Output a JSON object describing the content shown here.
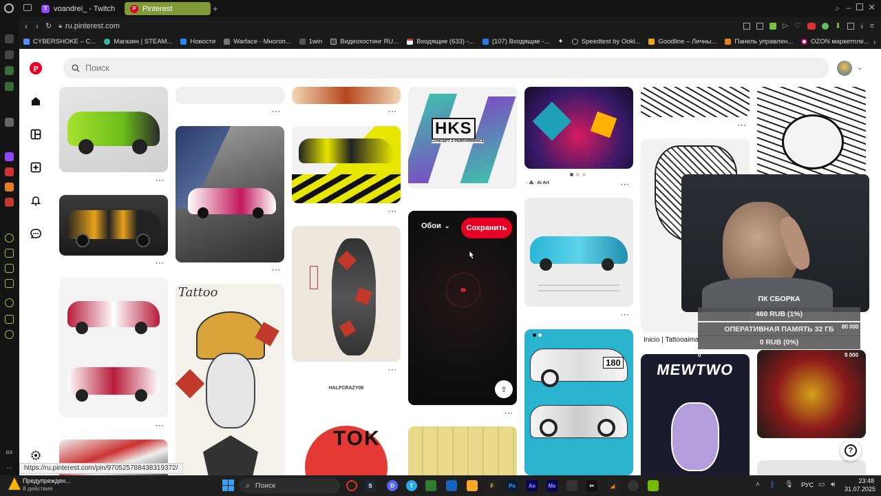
{
  "browser": {
    "tabs": [
      {
        "label": "voandrei_ - Twitch",
        "icon": "twitch-icon"
      },
      {
        "label": "Pinterest",
        "icon": "pinterest-icon"
      }
    ],
    "url": "ru.pinterest.com",
    "bookmarks": [
      "CYBERSHOKE – C...",
      "Магазин | STEAM...",
      "Новости",
      "Warface - Многоп...",
      "1win",
      "Видеохостинг RU...",
      "Входящие (633) -...",
      "(107) Входящие -...",
      "Speedtest by Ookl...",
      "Goodline – Личны...",
      "Панель управлен...",
      "OZON маркетплe..."
    ],
    "status_url": "https://ru.pinterest.com/pin/970525788438319372/"
  },
  "pinterest": {
    "search_placeholder": "Поиск",
    "hover_board": "Обои",
    "save_button": "Сохранить",
    "pin_captions": {
      "hks_logo": "HKS",
      "hks_sub": "CONCEPT Z PERFORMANCE",
      "ai_art": "∙ ⁂ ∙ AI Art",
      "tattoo_title": "Tattoo",
      "inicio_title": "Inicio | Tattooaima",
      "halfcrazy": "HALFCRAZY08",
      "tokyo": "TOK",
      "mewtwo": "MEWTWO",
      "num_180": "180",
      "dots": "···",
      "help": "?"
    }
  },
  "stream_overlay": {
    "title": "ПК СБОРКА",
    "goal1": "460 RUB (1%)",
    "ram_label": "ОПЕРАТИВНАЯ ПАМЯТЬ 32 ГБ",
    "goal2": "0 RUB (0%)",
    "num1": "80 000",
    "num2": "9 000",
    "num3": "0"
  },
  "taskbar": {
    "notify_title": "Предупрежден...",
    "notify_sub": "8 действия",
    "search": "Поиск",
    "lang": "РУС",
    "time": "23:48",
    "date": "31.07.2025"
  }
}
